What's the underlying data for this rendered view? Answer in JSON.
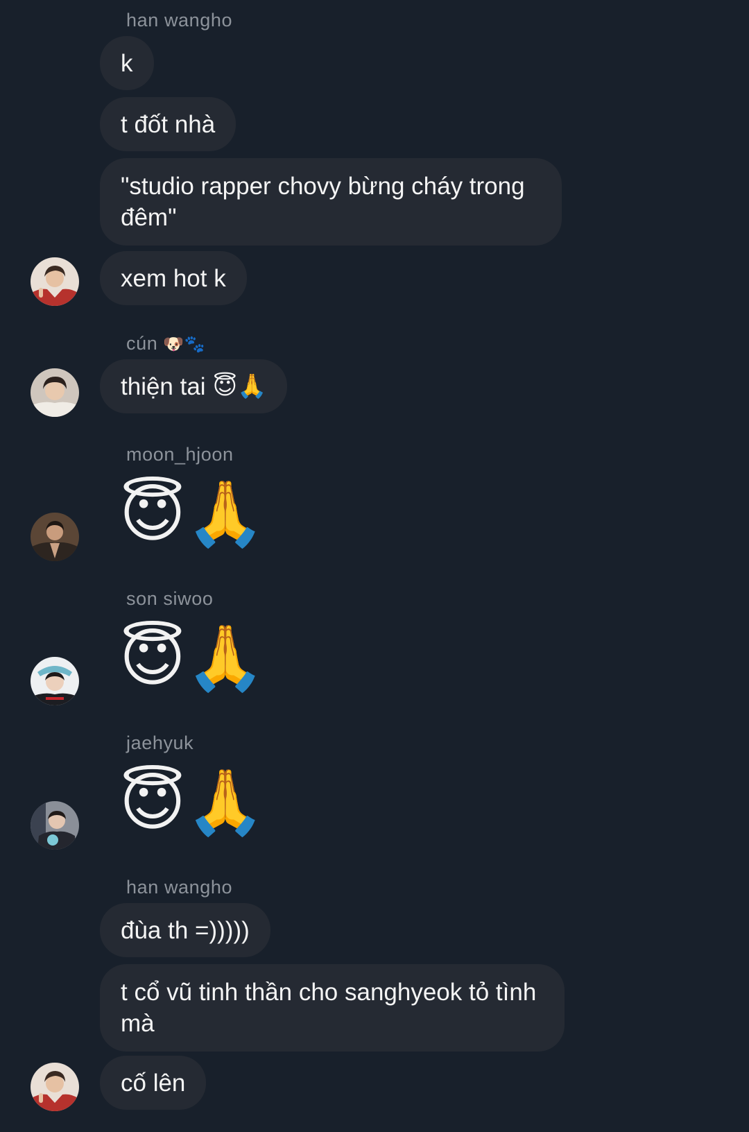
{
  "messages": [
    {
      "sender": "han wangho",
      "lines": [
        "k",
        "t đốt nhà",
        "\"studio rapper chovy bừng cháy trong đêm\"",
        "xem hot k"
      ]
    },
    {
      "sender": "cún",
      "sender_emoji": "🐶🐾",
      "text": "thiện tai",
      "emoji": "😇🙏"
    },
    {
      "sender": "moon_hjoon",
      "emoji": "😇🙏"
    },
    {
      "sender": "son siwoo",
      "emoji": "😇🙏"
    },
    {
      "sender": "jaehyuk",
      "emoji": "😇🙏"
    },
    {
      "sender": "han wangho",
      "lines": [
        "đùa th =)))))",
        "t cổ vũ tinh thần cho sanghyeok tỏ tình mà",
        "cố lên"
      ]
    }
  ],
  "colors": {
    "background": "#18202b",
    "bubble": "#252a33",
    "sender_name": "#8d939b",
    "text": "#f4f4f4"
  }
}
